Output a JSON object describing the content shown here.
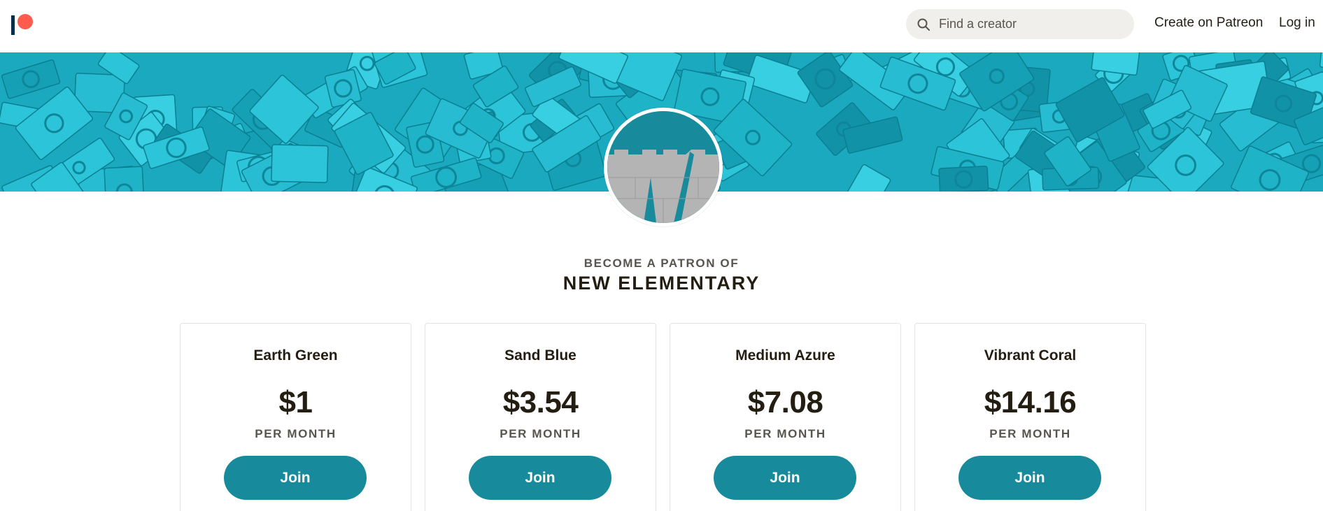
{
  "header": {
    "logo_name": "patreon-logo",
    "search": {
      "placeholder": "Find a creator",
      "value": "",
      "icon": "search-icon"
    },
    "create_link": "Create on Patreon",
    "login_link": "Log in"
  },
  "creator": {
    "subtitle": "BECOME A PATRON OF",
    "name": "NEW ELEMENTARY"
  },
  "tiers": [
    {
      "name": "Earth Green",
      "price": "$1",
      "period": "PER MONTH",
      "button": "Join"
    },
    {
      "name": "Sand Blue",
      "price": "$3.54",
      "period": "PER MONTH",
      "button": "Join"
    },
    {
      "name": "Medium Azure",
      "price": "$7.08",
      "period": "PER MONTH",
      "button": "Join"
    },
    {
      "name": "Vibrant Coral",
      "price": "$14.16",
      "period": "PER MONTH",
      "button": "Join"
    }
  ],
  "colors": {
    "accent": "#178b9c",
    "brand_coral": "#ff5c4d",
    "brand_navy": "#052d49",
    "banner_blue": "#22b6cb"
  }
}
